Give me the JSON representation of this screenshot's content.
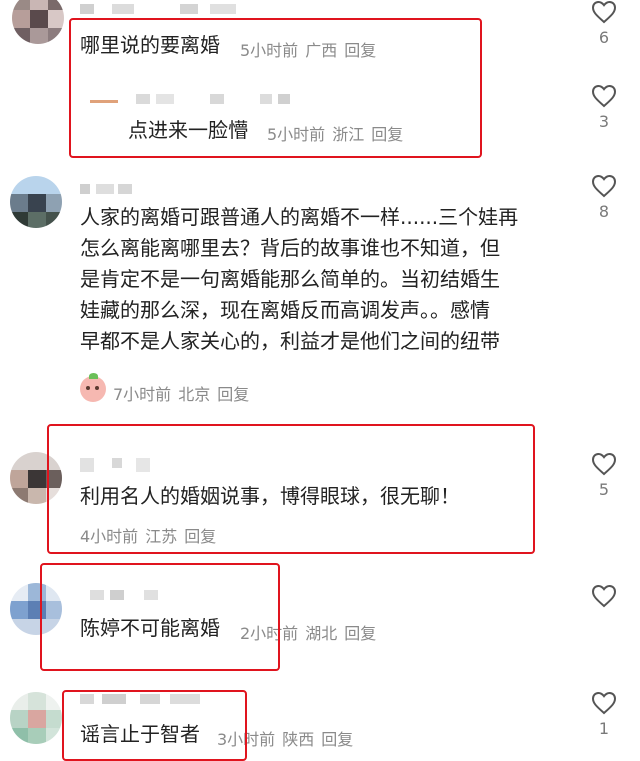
{
  "comments": [
    {
      "text_lines": [
        "哪里说的要离婚"
      ],
      "time": "5小时前",
      "location": "广西",
      "reply": "回复",
      "likes": "6",
      "replies": [
        {
          "text_lines": [
            "点进来一脸懵"
          ],
          "time": "5小时前",
          "location": "浙江",
          "reply": "回复",
          "likes": "3"
        }
      ]
    },
    {
      "text_lines": [
        "人家的离婚可跟普通人的离婚不一样......三个娃再",
        "怎么离能离哪里去？背后的故事谁也不知道，但",
        "是肯定不是一句离婚能那么简单的。当初结婚生",
        "娃藏的那么深，现在离婚反而高调发声。。感情",
        "早都不是人家关心的，利益才是他们之间的纽带"
      ],
      "time": "7小时前",
      "location": "北京",
      "reply": "回复",
      "likes": "8"
    },
    {
      "text_lines": [
        "利用名人的婚姻说事，博得眼球，很无聊！"
      ],
      "time": "4小时前",
      "location": "江苏",
      "reply": "回复",
      "likes": "5"
    },
    {
      "text_lines": [
        "陈婷不可能离婚"
      ],
      "time": "2小时前",
      "location": "湖北",
      "reply": "回复",
      "likes": ""
    },
    {
      "text_lines": [
        "谣言止于智者"
      ],
      "time": "3小时前",
      "location": "陕西",
      "reply": "回复",
      "likes": "1"
    }
  ],
  "colors": {
    "highlight_box": "#e0141e",
    "meta_text": "#8a8a8a"
  },
  "icons": {
    "like": "heart-outline-icon",
    "sticker": "peach-emoji-icon"
  }
}
